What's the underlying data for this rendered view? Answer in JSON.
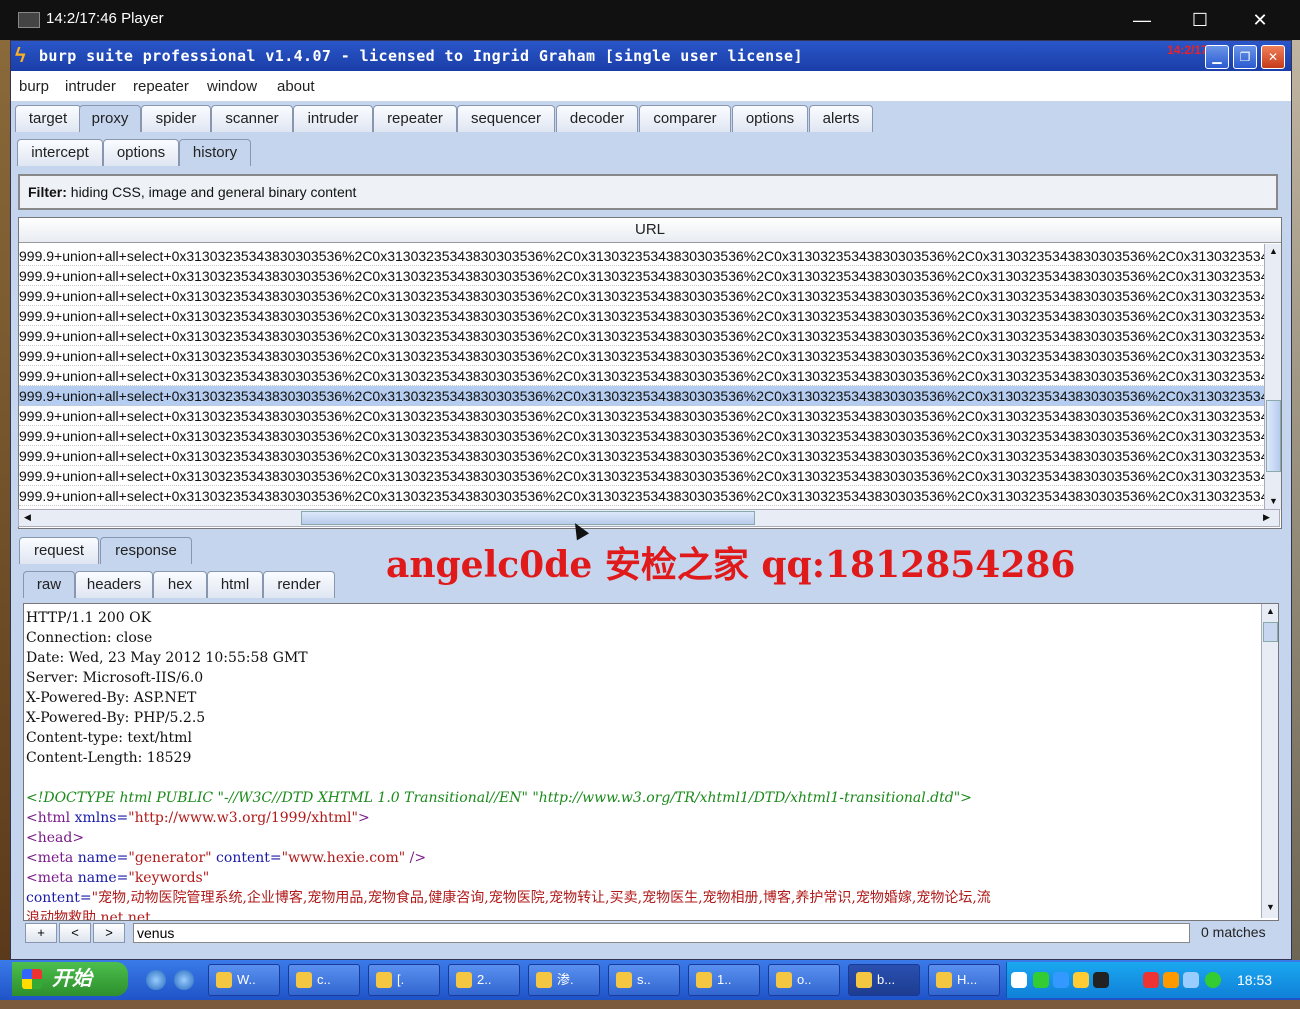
{
  "player": {
    "title": "14:2/17:46 Player",
    "min": "—",
    "max": "☐",
    "close": "✕"
  },
  "burp": {
    "title": "burp suite professional v1.4.07 - licensed to Ingrid Graham [single user license]",
    "stamp": "14:2/17:46"
  },
  "menu": [
    "burp",
    "intruder",
    "repeater",
    "window",
    "about"
  ],
  "main_tabs": [
    "target",
    "proxy",
    "spider",
    "scanner",
    "intruder",
    "repeater",
    "sequencer",
    "decoder",
    "comparer",
    "options",
    "alerts"
  ],
  "proxy_tabs": [
    "intercept",
    "options",
    "history"
  ],
  "filter": {
    "label": "Filter:",
    "text": "hiding CSS, image and general binary content"
  },
  "table": {
    "header": "URL",
    "row_text": "999.9+union+all+select+0x31303235343830303536%2C0x31303235343830303536%2C0x31303235343830303536%2C0x31303235343830303536%2C0x31303235343830303536%2C0x31303235343830303536",
    "row_count": 13,
    "selected_row": 7
  },
  "reqresp_tabs": [
    "request",
    "response"
  ],
  "view_tabs": [
    "raw",
    "headers",
    "hex",
    "html",
    "render"
  ],
  "response": {
    "headers": [
      "HTTP/1.1 200 OK",
      "Connection: close",
      "Date: Wed, 23 May 2012 10:55:58 GMT",
      "Server: Microsoft-IIS/6.0",
      "X-Powered-By: ASP.NET",
      "X-Powered-By: PHP/5.2.5",
      "Content-type: text/html",
      "Content-Length: 18529"
    ],
    "doctype": "<!DOCTYPE html PUBLIC \"-//W3C//DTD XHTML 1.0 Transitional//EN\" \"http://www.w3.org/TR/xhtml1/DTD/xhtml1-transitional.dtd\">",
    "html_open": "<html",
    "xmlns_attr": " xmlns=",
    "xmlns_val": "\"http://www.w3.org/1999/xhtml\"",
    "html_close": ">",
    "head": "<head>",
    "meta1_tag": "<meta",
    "meta1_name_attr": " name=",
    "meta1_name_val": "\"generator\"",
    "meta1_content_attr": " content=",
    "meta1_content_val": "\"www.hexie.com\"",
    "meta1_end": " />",
    "meta2_tag": "<meta",
    "meta2_name_attr": " name=",
    "meta2_name_val": "\"keywords\"",
    "content_attr": "content=",
    "content_val": "\"宠物,动物医院管理系统,企业博客,宠物用品,宠物食品,健康咨询,宠物医院,宠物转让,买卖,宠物医生,宠物相册,博客,养护常识,宠物婚嫁,宠物论坛,流",
    "partial_line": "浪动物救助,net,net"
  },
  "search": {
    "plus": "+",
    "prev": "<",
    "next": ">",
    "value": "venus",
    "matches": "0 matches"
  },
  "watermark": "angelc0de  安检之家  qq:1812854286",
  "taskbar": {
    "start": "开始",
    "buttons": [
      "W..",
      "c..",
      "[.",
      "2..",
      "渗.",
      "s..",
      "1..",
      "o..",
      "b...",
      "H..."
    ],
    "clock": "18:53"
  }
}
